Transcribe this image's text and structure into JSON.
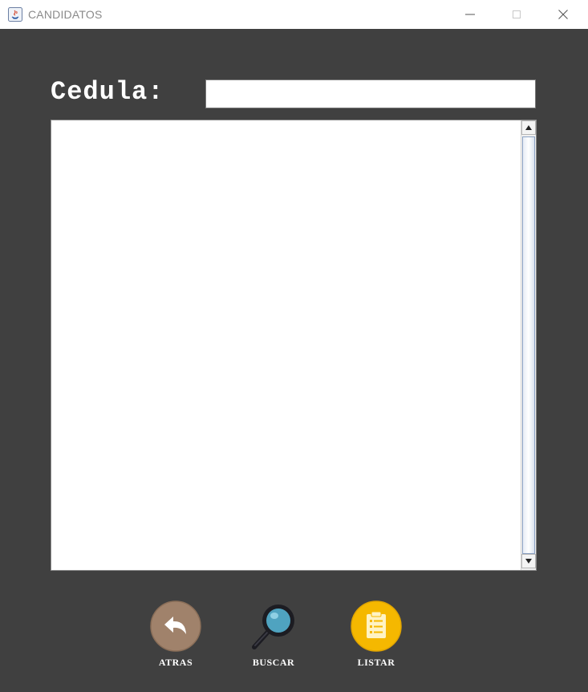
{
  "window": {
    "title": "CANDIDATOS",
    "minimize_icon": "minimize-icon",
    "maximize_icon": "maximize-icon",
    "close_icon": "close-icon"
  },
  "form": {
    "cedula_label": "Cedula:",
    "cedula_value": "",
    "results_text": ""
  },
  "actions": [
    {
      "label": "ATRAS",
      "icon": "back-arrow-icon",
      "color": "#a0826b"
    },
    {
      "label": "BUSCAR",
      "icon": "magnifier-icon",
      "color": "#4fa3c0"
    },
    {
      "label": "LISTAR",
      "icon": "clipboard-list-icon",
      "color": "#f5b800"
    }
  ]
}
